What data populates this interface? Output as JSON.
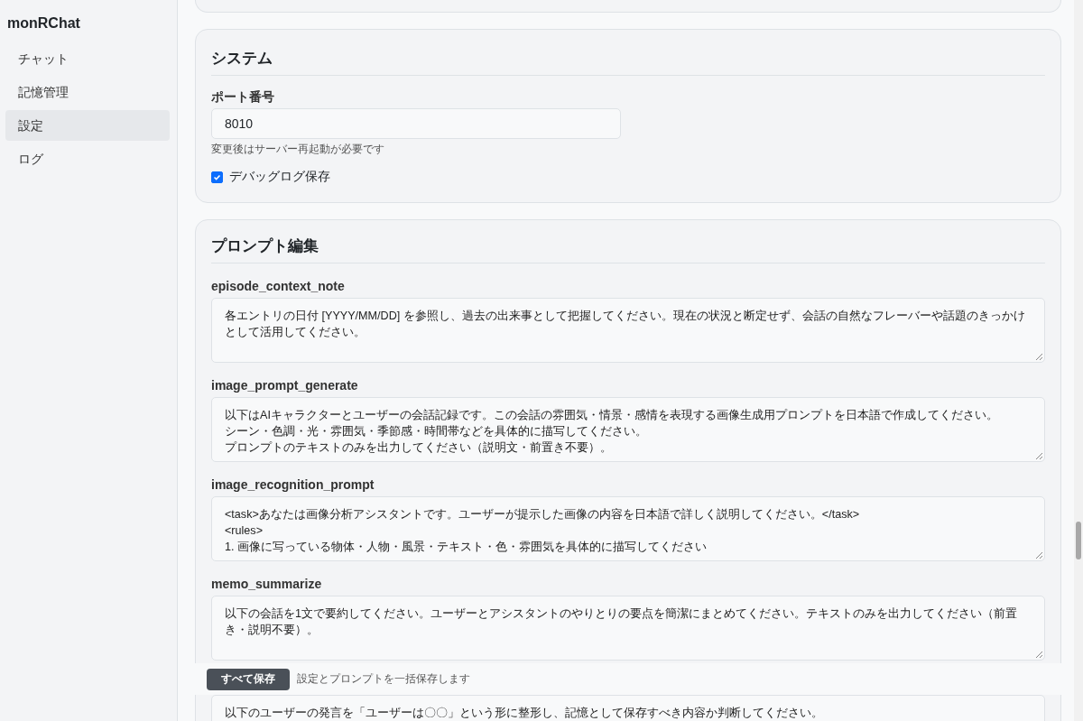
{
  "sidebar": {
    "title": "monRChat",
    "items": [
      {
        "label": "チャット",
        "selected": false
      },
      {
        "label": "記憶管理",
        "selected": false
      },
      {
        "label": "設定",
        "selected": true
      },
      {
        "label": "ログ",
        "selected": false
      }
    ]
  },
  "system": {
    "heading": "システム",
    "port_label": "ポート番号",
    "port_value": "8010",
    "port_hint": "変更後はサーバー再起動が必要です",
    "debug_log": {
      "label": "デバッグログ保存",
      "checked": true
    }
  },
  "prompts": {
    "heading": "プロンプト編集",
    "fields": [
      {
        "label": "episode_context_note",
        "lines": [
          "各エントリの日付 [YYYY/MM/DD] を参照し、過去の出来事として把握してください。現在の状況と断定せず、会話の自然なフレーバーや話題のきっかけとして活用してください。"
        ]
      },
      {
        "label": "image_prompt_generate",
        "lines": [
          "以下はAIキャラクターとユーザーの会話記録です。この会話の雰囲気・情景・感情を表現する画像生成用プロンプトを日本語で作成してください。",
          "シーン・色調・光・雰囲気・季節感・時間帯などを具体的に描写してください。",
          "プロンプトのテキストのみを出力してください（説明文・前置き不要）。"
        ]
      },
      {
        "label": "image_recognition_prompt",
        "lines": [
          "<task>あなたは画像分析アシスタントです。ユーザーが提示した画像の内容を日本語で詳しく説明してください。</task>",
          "<rules>",
          "1. 画像に写っている物体・人物・風景・テキスト・色・雰囲気を具体的に描写してください"
        ]
      },
      {
        "label": "memo_summarize",
        "lines": [
          "以下の会話を1文で要約してください。ユーザーとアシスタントのやりとりの要点を簡潔にまとめてください。テキストのみを出力してください（前置き・説明不要）。"
        ]
      },
      {
        "lines": [
          "以下のユーザーの発言を「ユーザーは〇〇」という形に整形し、記憶として保存すべき内容か判断してください。"
        ]
      }
    ]
  },
  "save_bar": {
    "button": "すべて保存",
    "hint": "設定とプロンプトを一括保存します"
  }
}
